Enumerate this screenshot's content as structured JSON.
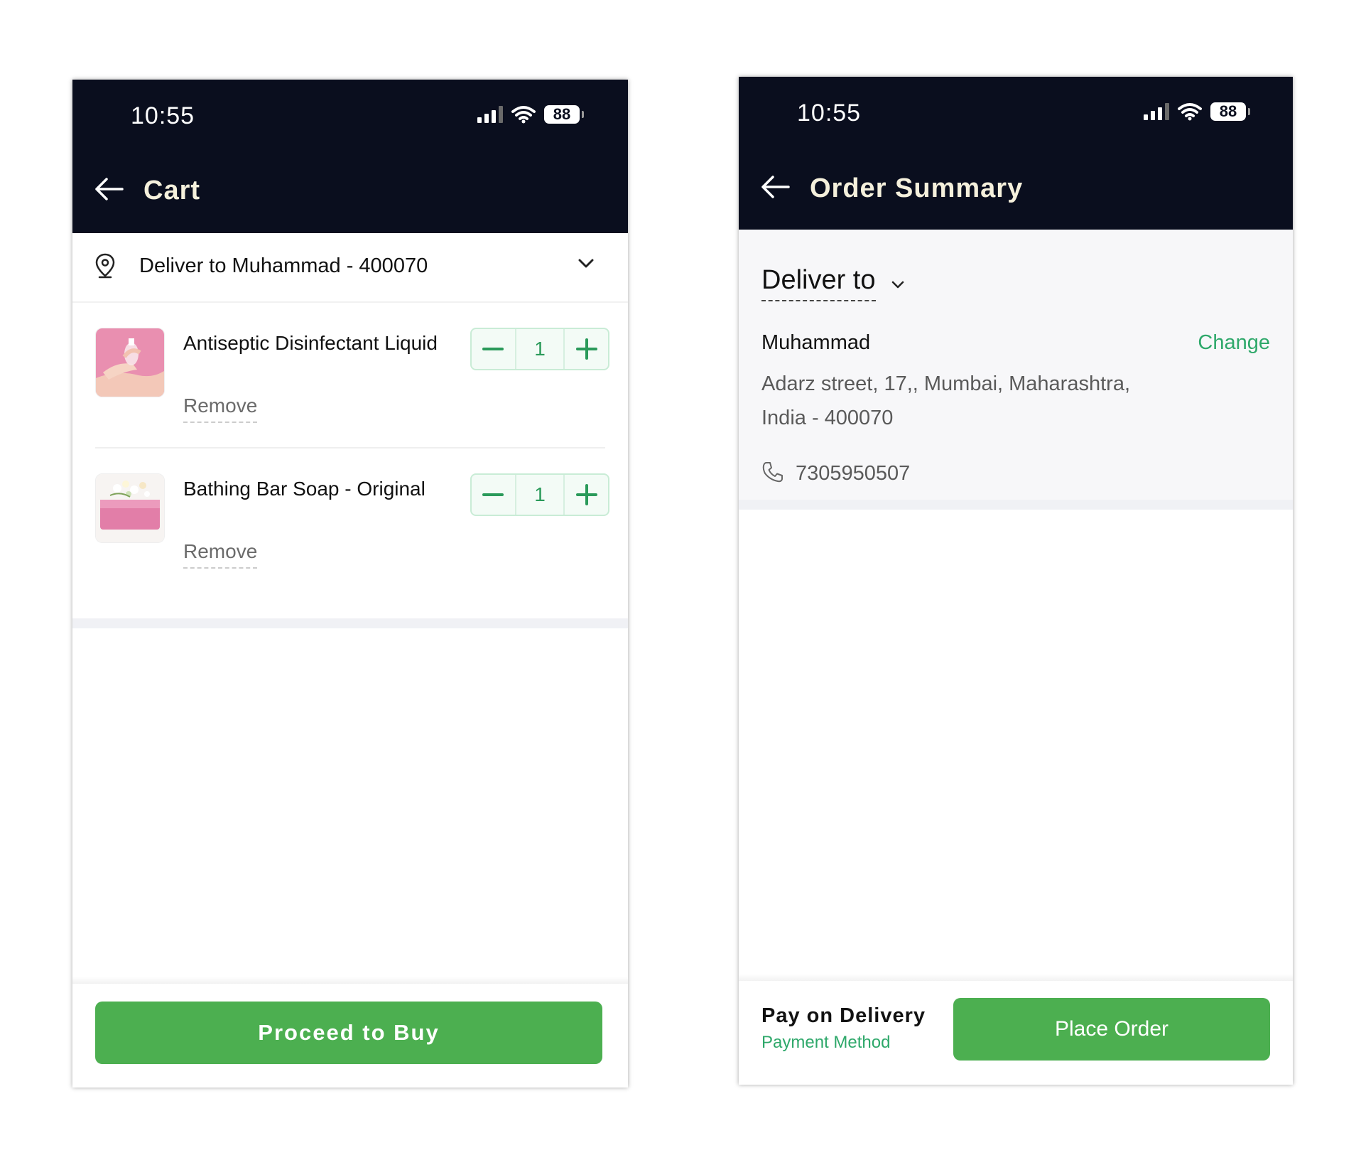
{
  "cart_screen": {
    "status_bar": {
      "time": "10:55",
      "battery": "88"
    },
    "header": {
      "title": "Cart"
    },
    "delivery": {
      "text": "Deliver to Muhammad - 400070"
    },
    "items": [
      {
        "name": "Antiseptic Disinfectant Liquid",
        "quantity": "1",
        "remove_label": "Remove"
      },
      {
        "name": "Bathing Bar Soap - Original",
        "quantity": "1",
        "remove_label": "Remove"
      }
    ],
    "proceed_label": "Proceed to Buy"
  },
  "summary_screen": {
    "status_bar": {
      "time": "10:55",
      "battery": "88"
    },
    "header": {
      "title": "Order Summary"
    },
    "deliver_to_label": "Deliver to",
    "address": {
      "name": "Muhammad",
      "change_label": "Change",
      "line1": "Adarz street, 17,, Mumbai, Maharashtra,",
      "line2": "India - 400070",
      "phone": "7305950507"
    },
    "payment": {
      "title": "Pay on Delivery",
      "subtitle": "Payment Method"
    },
    "place_order_label": "Place Order"
  },
  "colors": {
    "header_bg": "#0a0e1e",
    "accent_green": "#4caf50",
    "link_green": "#2ea86a"
  }
}
